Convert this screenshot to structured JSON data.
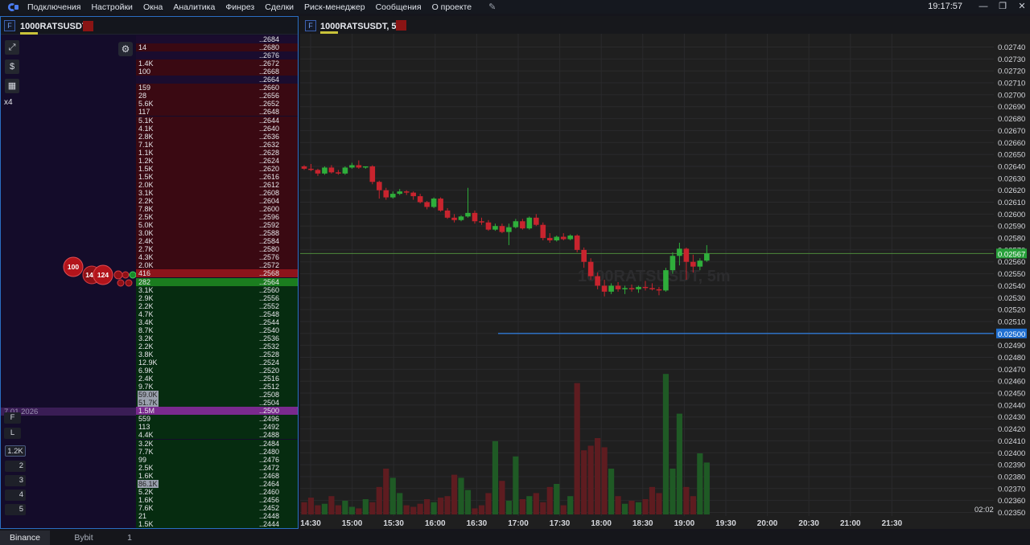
{
  "menubar": {
    "items": [
      "Подключения",
      "Настройки",
      "Окна",
      "Аналитика",
      "Финрез",
      "Сделки",
      "Риск-менеджер",
      "Сообщения",
      "О проекте"
    ],
    "clock": "19:17:57"
  },
  "left_panel": {
    "badge": "F",
    "symbol": "1000RATSUSDT",
    "multiplier": "x4",
    "date_label": "7.01.2026",
    "side_buttons": [
      "F",
      "L",
      "1.2K",
      "2",
      "3",
      "4",
      "5"
    ],
    "bubbles": [
      "100",
      "14",
      "124"
    ],
    "ladder": [
      {
        "vol": "",
        "price": "..2684",
        "side": "ask",
        "dark": true
      },
      {
        "vol": "14",
        "price": "..2680",
        "side": "ask"
      },
      {
        "vol": "",
        "price": "..2676",
        "side": "ask",
        "dark": true
      },
      {
        "vol": "1.4K",
        "price": "..2672",
        "side": "ask"
      },
      {
        "vol": "100",
        "price": "..2668",
        "side": "ask"
      },
      {
        "vol": "",
        "price": "..2664",
        "side": "ask",
        "dark": true
      },
      {
        "vol": "159",
        "price": "..2660",
        "side": "ask"
      },
      {
        "vol": "28",
        "price": "..2656",
        "side": "ask"
      },
      {
        "vol": "5.6K",
        "price": "..2652",
        "side": "ask"
      },
      {
        "vol": "117",
        "price": "..2648",
        "side": "ask"
      },
      {
        "vol": "5.1K",
        "price": "..2644",
        "side": "ask"
      },
      {
        "vol": "4.1K",
        "price": "..2640",
        "side": "ask"
      },
      {
        "vol": "2.8K",
        "price": "..2636",
        "side": "ask"
      },
      {
        "vol": "7.1K",
        "price": "..2632",
        "side": "ask"
      },
      {
        "vol": "1.1K",
        "price": "..2628",
        "side": "ask"
      },
      {
        "vol": "1.2K",
        "price": "..2624",
        "side": "ask"
      },
      {
        "vol": "1.5K",
        "price": "..2620",
        "side": "ask"
      },
      {
        "vol": "1.5K",
        "price": "..2616",
        "side": "ask"
      },
      {
        "vol": "2.0K",
        "price": "..2612",
        "side": "ask"
      },
      {
        "vol": "3.1K",
        "price": "..2608",
        "side": "ask"
      },
      {
        "vol": "2.2K",
        "price": "..2604",
        "side": "ask"
      },
      {
        "vol": "7.8K",
        "price": "..2600",
        "side": "ask"
      },
      {
        "vol": "2.5K",
        "price": "..2596",
        "side": "ask"
      },
      {
        "vol": "5.0K",
        "price": "..2592",
        "side": "ask"
      },
      {
        "vol": "3.0K",
        "price": "..2588",
        "side": "ask"
      },
      {
        "vol": "2.4K",
        "price": "..2584",
        "side": "ask"
      },
      {
        "vol": "2.7K",
        "price": "..2580",
        "side": "ask"
      },
      {
        "vol": "4.3K",
        "price": "..2576",
        "side": "ask"
      },
      {
        "vol": "2.0K",
        "price": "..2572",
        "side": "ask"
      },
      {
        "vol": "416",
        "price": "..2568",
        "side": "best_ask"
      },
      {
        "vol": "282",
        "price": "..2564",
        "side": "best_bid"
      },
      {
        "vol": "3.1K",
        "price": "..2560",
        "side": "bid"
      },
      {
        "vol": "2.9K",
        "price": "..2556",
        "side": "bid"
      },
      {
        "vol": "2.2K",
        "price": "..2552",
        "side": "bid"
      },
      {
        "vol": "4.7K",
        "price": "..2548",
        "side": "bid"
      },
      {
        "vol": "3.4K",
        "price": "..2544",
        "side": "bid"
      },
      {
        "vol": "8.7K",
        "price": "..2540",
        "side": "bid"
      },
      {
        "vol": "3.2K",
        "price": "..2536",
        "side": "bid"
      },
      {
        "vol": "2.2K",
        "price": "..2532",
        "side": "bid"
      },
      {
        "vol": "3.8K",
        "price": "..2528",
        "side": "bid"
      },
      {
        "vol": "12.9K",
        "price": "..2524",
        "side": "bid"
      },
      {
        "vol": "6.9K",
        "price": "..2520",
        "side": "bid"
      },
      {
        "vol": "2.4K",
        "price": "..2516",
        "side": "bid"
      },
      {
        "vol": "9.7K",
        "price": "..2512",
        "side": "bid"
      },
      {
        "vol": "59.0K",
        "price": "..2508",
        "side": "bid",
        "highlight": true
      },
      {
        "vol": "51.7K",
        "price": "..2504",
        "side": "bid",
        "highlight": true
      },
      {
        "vol": "1.5M",
        "price": "..2500",
        "side": "marked"
      },
      {
        "vol": "559",
        "price": "..2496",
        "side": "bid"
      },
      {
        "vol": "113",
        "price": "..2492",
        "side": "bid"
      },
      {
        "vol": "4.4K",
        "price": "..2488",
        "side": "bid"
      },
      {
        "vol": "3.2K",
        "price": "..2484",
        "side": "bid"
      },
      {
        "vol": "7.7K",
        "price": "..2480",
        "side": "bid"
      },
      {
        "vol": "99",
        "price": "..2476",
        "side": "bid"
      },
      {
        "vol": "2.5K",
        "price": "..2472",
        "side": "bid"
      },
      {
        "vol": "1.6K",
        "price": "..2468",
        "side": "bid"
      },
      {
        "vol": "86.1K",
        "price": "..2464",
        "side": "bid",
        "highlight": true
      },
      {
        "vol": "5.2K",
        "price": "..2460",
        "side": "bid"
      },
      {
        "vol": "1.6K",
        "price": "..2456",
        "side": "bid"
      },
      {
        "vol": "7.6K",
        "price": "..2452",
        "side": "bid"
      },
      {
        "vol": "21",
        "price": "..2448",
        "side": "bid"
      },
      {
        "vol": "1.5K",
        "price": "..2444",
        "side": "bid"
      }
    ]
  },
  "chart_panel": {
    "badge": "F",
    "title": "1000RATSUSDT, 5m",
    "watermark": "1000RATSUSDT, 5m",
    "timer": "02:02",
    "current_price_label": "0.02567",
    "level_label": "0.02500"
  },
  "chart_data": {
    "type": "candlestick",
    "y_ticks": [
      "0.02740",
      "0.02730",
      "0.02720",
      "0.02710",
      "0.02700",
      "0.02690",
      "0.02680",
      "0.02670",
      "0.02660",
      "0.02650",
      "0.02640",
      "0.02630",
      "0.02620",
      "0.02610",
      "0.02600",
      "0.02590",
      "0.02580",
      "0.02570",
      "0.02560",
      "0.02550",
      "0.02540",
      "0.02530",
      "0.02520",
      "0.02510",
      "0.02500",
      "0.02490",
      "0.02480",
      "0.02470",
      "0.02460",
      "0.02450",
      "0.02440",
      "0.02430",
      "0.02420",
      "0.02410",
      "0.02400",
      "0.02390",
      "0.02380",
      "0.02370",
      "0.02360",
      "0.02350"
    ],
    "x_ticks": [
      "14:30",
      "15:00",
      "15:30",
      "16:00",
      "16:30",
      "17:00",
      "17:30",
      "18:00",
      "18:30",
      "19:00",
      "19:30",
      "20:00",
      "20:30",
      "21:00",
      "21:30"
    ],
    "ylim": [
      0.02345,
      0.02745
    ],
    "current_price": 0.02567,
    "horizontal_level": 0.025,
    "candles": [
      [
        0.0264,
        0.02641,
        0.02637,
        0.02638
      ],
      [
        0.02638,
        0.02642,
        0.02636,
        0.02637
      ],
      [
        0.02637,
        0.02638,
        0.02632,
        0.02634
      ],
      [
        0.02634,
        0.0264,
        0.02633,
        0.02639
      ],
      [
        0.02639,
        0.02641,
        0.02634,
        0.02635
      ],
      [
        0.02635,
        0.02637,
        0.02633,
        0.02634
      ],
      [
        0.02634,
        0.0264,
        0.02633,
        0.02639
      ],
      [
        0.02639,
        0.02643,
        0.02638,
        0.02641
      ],
      [
        0.02641,
        0.02645,
        0.02638,
        0.02639
      ],
      [
        0.02639,
        0.0264,
        0.02638,
        0.0264
      ],
      [
        0.0264,
        0.02641,
        0.02625,
        0.02627
      ],
      [
        0.02627,
        0.02628,
        0.02613,
        0.0262
      ],
      [
        0.0262,
        0.02622,
        0.02612,
        0.02614
      ],
      [
        0.02614,
        0.02619,
        0.02613,
        0.02617
      ],
      [
        0.02617,
        0.02621,
        0.02616,
        0.02619
      ],
      [
        0.02619,
        0.0262,
        0.02616,
        0.02618
      ],
      [
        0.02618,
        0.02619,
        0.02612,
        0.02615
      ],
      [
        0.02615,
        0.02617,
        0.02609,
        0.0261
      ],
      [
        0.0261,
        0.02611,
        0.02604,
        0.02606
      ],
      [
        0.02606,
        0.02614,
        0.02605,
        0.02613
      ],
      [
        0.02613,
        0.02614,
        0.02602,
        0.02603
      ],
      [
        0.02603,
        0.02605,
        0.02596,
        0.02597
      ],
      [
        0.02597,
        0.026,
        0.02593,
        0.02595
      ],
      [
        0.02595,
        0.02599,
        0.02594,
        0.02598
      ],
      [
        0.02598,
        0.02622,
        0.02597,
        0.02601
      ],
      [
        0.02601,
        0.02603,
        0.02592,
        0.02594
      ],
      [
        0.02594,
        0.02597,
        0.02591,
        0.02593
      ],
      [
        0.02593,
        0.02595,
        0.02586,
        0.02587
      ],
      [
        0.02587,
        0.02592,
        0.02586,
        0.0259
      ],
      [
        0.0259,
        0.02592,
        0.02584,
        0.02585
      ],
      [
        0.02585,
        0.02592,
        0.02574,
        0.02589
      ],
      [
        0.02589,
        0.02596,
        0.02588,
        0.02594
      ],
      [
        0.02594,
        0.02596,
        0.02587,
        0.02588
      ],
      [
        0.02588,
        0.02598,
        0.02587,
        0.02597
      ],
      [
        0.02597,
        0.026,
        0.0259,
        0.02591
      ],
      [
        0.02591,
        0.02593,
        0.02578,
        0.0258
      ],
      [
        0.0258,
        0.02584,
        0.02576,
        0.02578
      ],
      [
        0.02578,
        0.02582,
        0.02577,
        0.02581
      ],
      [
        0.02581,
        0.02584,
        0.02578,
        0.02579
      ],
      [
        0.02579,
        0.02583,
        0.02578,
        0.02582
      ],
      [
        0.02582,
        0.02583,
        0.02568,
        0.0257
      ],
      [
        0.0257,
        0.02572,
        0.02555,
        0.0256
      ],
      [
        0.0256,
        0.02563,
        0.02545,
        0.02548
      ],
      [
        0.02548,
        0.02551,
        0.02537,
        0.0254
      ],
      [
        0.0254,
        0.02545,
        0.02531,
        0.02535
      ],
      [
        0.02535,
        0.02542,
        0.02533,
        0.0254
      ],
      [
        0.0254,
        0.02543,
        0.02535,
        0.02537
      ],
      [
        0.02537,
        0.0254,
        0.02533,
        0.02538
      ],
      [
        0.02538,
        0.02541,
        0.02535,
        0.02537
      ],
      [
        0.02537,
        0.0254,
        0.02534,
        0.02539
      ],
      [
        0.02539,
        0.02544,
        0.02536,
        0.02538
      ],
      [
        0.02538,
        0.02542,
        0.02536,
        0.02537
      ],
      [
        0.02537,
        0.02539,
        0.02532,
        0.02536
      ],
      [
        0.02536,
        0.02555,
        0.02535,
        0.02553
      ],
      [
        0.02553,
        0.02568,
        0.0255,
        0.02565
      ],
      [
        0.02565,
        0.02576,
        0.02557,
        0.02571
      ],
      [
        0.02571,
        0.02572,
        0.02545,
        0.0256
      ],
      [
        0.0256,
        0.02566,
        0.02551,
        0.02556
      ],
      [
        0.02556,
        0.02563,
        0.02553,
        0.02561
      ],
      [
        0.02561,
        0.02574,
        0.0256,
        0.02567
      ]
    ],
    "volumes": [
      0.08,
      0.11,
      0.06,
      0.07,
      0.12,
      0.06,
      0.09,
      0.05,
      0.04,
      0.1,
      0.08,
      0.18,
      0.3,
      0.24,
      0.14,
      0.06,
      0.05,
      0.07,
      0.1,
      0.08,
      0.11,
      0.12,
      0.26,
      0.24,
      0.16,
      0.04,
      0.06,
      0.14,
      0.48,
      0.22,
      0.09,
      0.38,
      0.1,
      0.12,
      0.14,
      0.08,
      0.18,
      0.2,
      0.06,
      0.12,
      0.86,
      0.42,
      0.45,
      0.5,
      0.44,
      0.3,
      0.12,
      0.07,
      0.09,
      0.08,
      0.1,
      0.18,
      0.14,
      0.92,
      0.3,
      0.66,
      0.18,
      0.12,
      0.4,
      0.34
    ]
  },
  "bottom_tabs": [
    "Binance",
    "Bybit",
    "1"
  ]
}
